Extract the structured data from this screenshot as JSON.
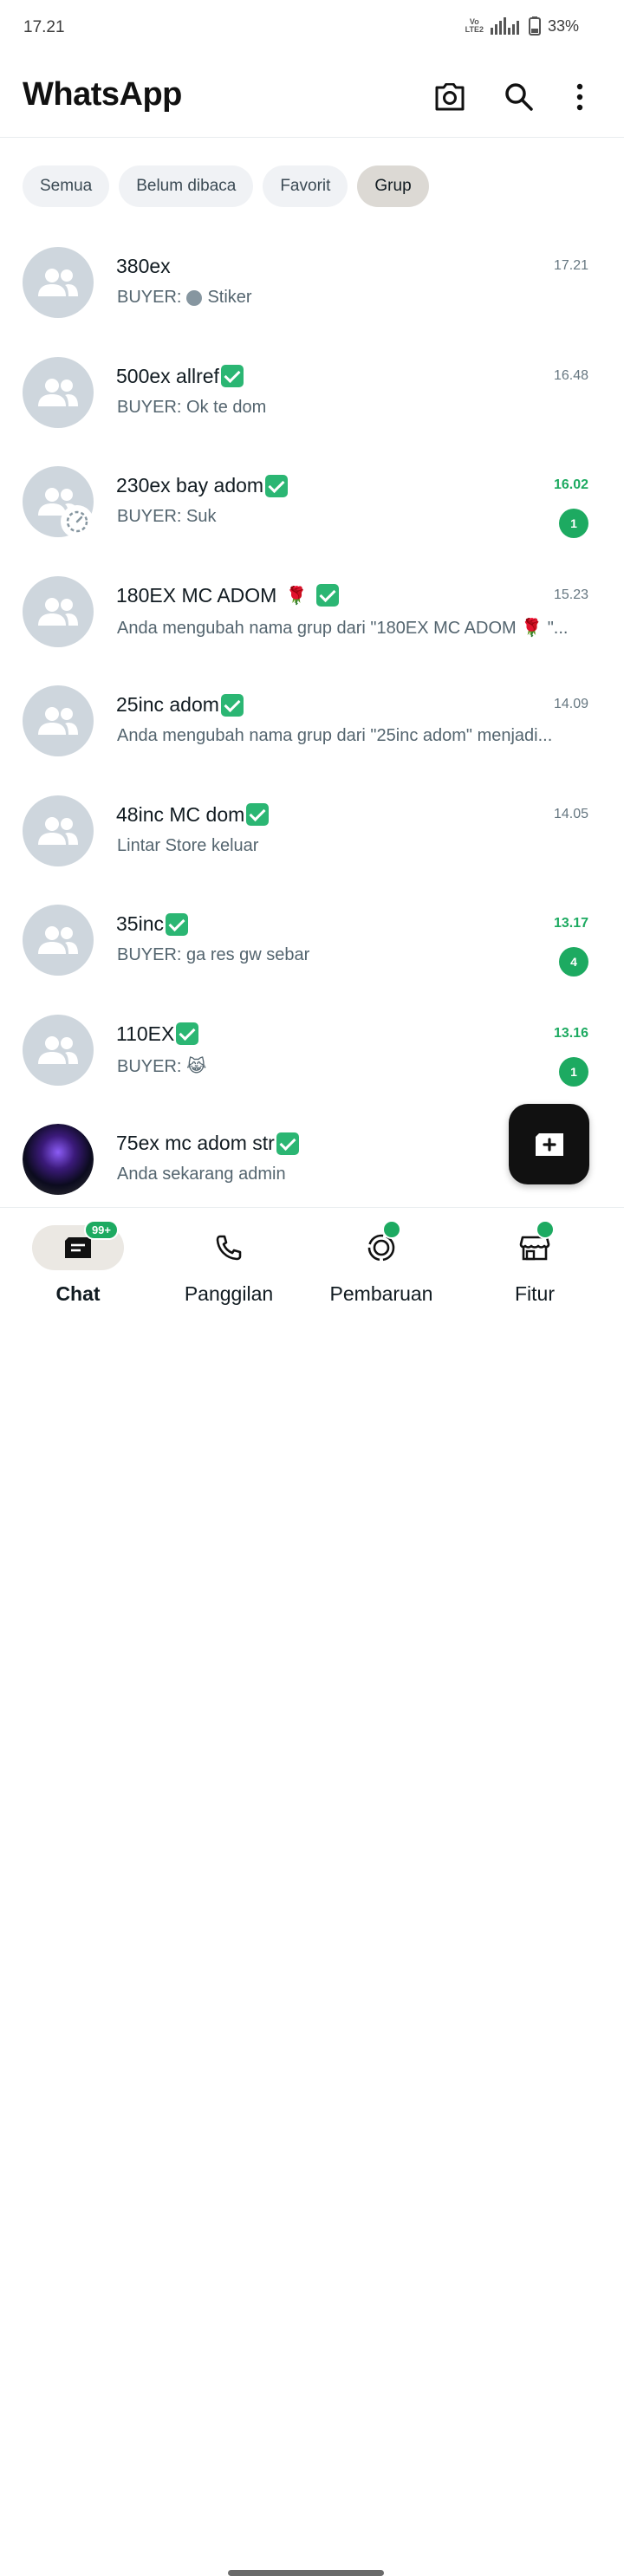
{
  "status_bar": {
    "time": "17.21",
    "network": "VoD LTE2 4G",
    "battery": "33%"
  },
  "header": {
    "title": "WhatsApp",
    "icons": [
      "camera-icon",
      "search-icon",
      "more-vert-icon"
    ]
  },
  "filters": [
    {
      "label": "Semua",
      "active": false
    },
    {
      "label": "Belum dibaca",
      "active": false
    },
    {
      "label": "Favorit",
      "active": false
    },
    {
      "label": "Grup",
      "active": true
    }
  ],
  "chats": [
    {
      "name": "380ex",
      "sender": "BUYER:",
      "preview": "Stiker",
      "time": "17.21",
      "unread": "",
      "verified": false
    },
    {
      "name": "500ex allref",
      "sender": "",
      "preview": "BUYER: Ok te dom",
      "time": "16.48",
      "unread": "",
      "verified": true
    },
    {
      "name": "230ex bay adom",
      "sender": "",
      "preview": "BUYER: Suk",
      "time": "16.02",
      "unread": "1",
      "verified": true
    },
    {
      "name": "180EX MC ADOM",
      "sender": "",
      "preview": "Anda mengubah nama grup dari \"180EX MC ADOM 🌹 \"...",
      "time": "15.23",
      "unread": "",
      "verified": true
    },
    {
      "name": "25inc adom",
      "sender": "",
      "preview": "Anda mengubah nama grup dari \"25inc adom\" menjadi...",
      "time": "14.09",
      "unread": "",
      "verified": true
    },
    {
      "name": "48inc MC dom",
      "sender": "",
      "preview": "Lintar Store keluar",
      "time": "14.05",
      "unread": "",
      "verified": true
    },
    {
      "name": "35inc",
      "sender": "",
      "preview": "BUYER: ga res gw sebar",
      "time": "13.17",
      "unread": "4",
      "verified": true
    },
    {
      "name": "110EX",
      "sender": "",
      "preview": "BUYER: 😹",
      "time": "13.16",
      "unread": "1",
      "verified": true
    },
    {
      "name": "75ex mc adom str",
      "sender": "",
      "preview": "Anda sekarang admin",
      "time": "",
      "unread": "",
      "verified": true
    }
  ],
  "bottom_nav": [
    {
      "label": "Chat",
      "badge": "99+",
      "active": true
    },
    {
      "label": "Panggilan",
      "badge": "",
      "active": false
    },
    {
      "label": "Pembaruan",
      "badge": "",
      "active": false
    },
    {
      "label": "Fitur",
      "badge": "",
      "active": false
    }
  ],
  "colors": {
    "accent": "#1daa61",
    "avatar_bg": "#ced6dd",
    "chip_bg": "#f0f2f5",
    "chip_active_bg": "#dcd9d4",
    "fab_bg": "#111111"
  }
}
